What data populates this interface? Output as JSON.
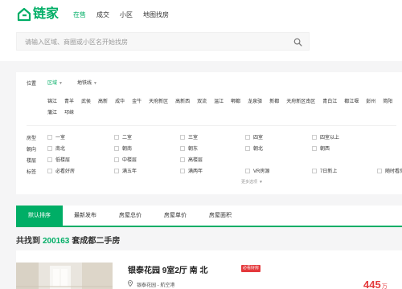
{
  "brand": {
    "name": "链家",
    "accent": "#00ae66"
  },
  "nav": [
    "在售",
    "成交",
    "小区",
    "地图找房"
  ],
  "search": {
    "placeholder": "请输入区域、商圈或小区名开始找房",
    "icon": "search-icon"
  },
  "filter": {
    "position_label": "位置",
    "position_tabs": [
      "区域",
      "地铁线"
    ],
    "districts": [
      "锦江",
      "青羊",
      "武侯",
      "高新",
      "成华",
      "金牛",
      "天府新区",
      "高新西",
      "双流",
      "温江",
      "郫都",
      "龙泉驿",
      "新都",
      "天府新区南区",
      "青白江",
      "都江堰",
      "彭州",
      "简阳",
      "蒲江",
      "邛崃"
    ],
    "rows": [
      {
        "label": "房型",
        "options": [
          "一室",
          "二室",
          "三室",
          "四室",
          "四室以上"
        ]
      },
      {
        "label": "朝向",
        "options": [
          "南北",
          "朝南",
          "朝东",
          "朝北",
          "朝西"
        ]
      },
      {
        "label": "楼层",
        "options": [
          "低楼层",
          "中楼层",
          "高楼层"
        ]
      },
      {
        "label": "标签",
        "options": [
          "必看好房",
          "满五年",
          "满两年",
          "VR房源",
          "7日新上",
          "随时看房"
        ]
      }
    ],
    "more": "更多选项"
  },
  "sort_tabs": [
    "默认排序",
    "最新发布",
    "房屋总价",
    "房屋单价",
    "房屋面积"
  ],
  "result": {
    "prefix": "共找到",
    "count": "200163",
    "suffix": "套成都二手房"
  },
  "listing": {
    "title": "银泰花园 9室2厅 南 北",
    "badge": "必看好房",
    "location": "银泰花园 - 航空港",
    "price": "445",
    "price_unit": "万"
  }
}
